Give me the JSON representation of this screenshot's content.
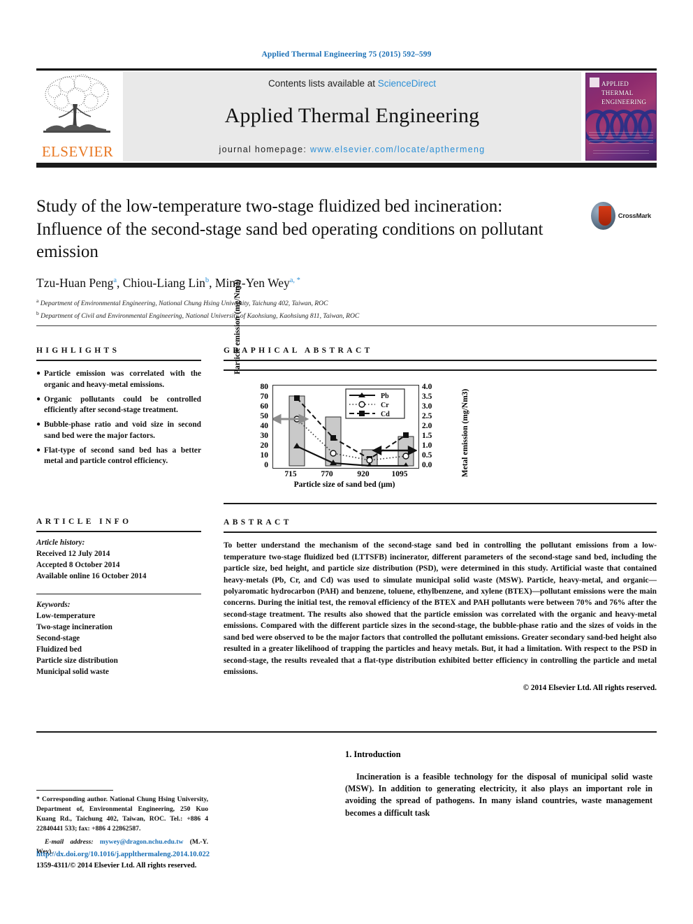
{
  "running_head": "Applied Thermal Engineering 75 (2015) 592–599",
  "masthead": {
    "contents_prefix": "Contents lists available at ",
    "sciencedirect": "ScienceDirect",
    "journal_name": "Applied Thermal Engineering",
    "homepage_label": "journal homepage:",
    "homepage_url": "www.elsevier.com/locate/apthermeng",
    "publisher": "ELSEVIER",
    "cover_title_line1": "APPLIED",
    "cover_title_line2": "THERMAL",
    "cover_title_line3": "ENGINEERING"
  },
  "article": {
    "title": "Study of the low-temperature two-stage fluidized bed incineration: Influence of the second-stage sand bed operating conditions on pollutant emission",
    "crossmark_label": "CrossMark",
    "authors": [
      {
        "name": "Tzu-Huan Peng",
        "marks": "a"
      },
      {
        "name": "Chiou-Liang Lin",
        "marks": "b"
      },
      {
        "name": "Ming-Yen Wey",
        "marks": "a, *"
      }
    ],
    "affiliations": [
      {
        "mark": "a",
        "text": "Department of Environmental Engineering, National Chung Hsing University, Taichung 402, Taiwan, ROC"
      },
      {
        "mark": "b",
        "text": "Department of Civil and Environmental Engineering, National University of Kaohsiung, Kaohsiung 811, Taiwan, ROC"
      }
    ]
  },
  "highlights": {
    "heading": "HIGHLIGHTS",
    "bullet": "●",
    "items": [
      "Particle emission was correlated with the organic and heavy-metal emissions.",
      "Organic pollutants could be controlled efficiently after second-stage treatment.",
      "Bubble-phase ratio and void size in second sand bed were the major factors.",
      "Flat-type of second sand bed has a better metal and particle control efficiency."
    ]
  },
  "article_info": {
    "heading": "ARTICLE INFO",
    "history_label": "Article history:",
    "history": [
      "Received 12 July 2014",
      "Accepted 8 October 2014",
      "Available online 16 October 2014"
    ],
    "keywords_label": "Keywords:",
    "keywords": [
      "Low-temperature",
      "Two-stage incineration",
      "Second-stage",
      "Fluidized bed",
      "Particle size distribution",
      "Municipal solid waste"
    ]
  },
  "graphical_abstract": {
    "heading": "GRAPHICAL ABSTRACT"
  },
  "chart_data": {
    "type": "bar",
    "title": "",
    "xlabel": "Particle size of sand bed (μm)",
    "ylabel": "Particle emission (mg/Nm3)",
    "ylabel_right": "Metal emission (mg/Nm3)",
    "categories": [
      "715",
      "770",
      "920",
      "1095"
    ],
    "ylim": [
      0,
      80
    ],
    "yticks": [
      "80",
      "70",
      "60",
      "50",
      "40",
      "30",
      "20",
      "10",
      "0"
    ],
    "ylim_right": [
      0.0,
      4.0
    ],
    "yticks_right": [
      "4.0",
      "3.5",
      "3.0",
      "2.5",
      "2.0",
      "1.5",
      "1.0",
      "0.5",
      "0.0"
    ],
    "grid": false,
    "legend_position": "top-right",
    "bar_series": {
      "name": "Particle emission",
      "values": [
        72,
        50,
        16,
        30
      ]
    },
    "series": [
      {
        "name": "Pb",
        "marker": "triangle",
        "line": "solid",
        "values": [
          1.0,
          0.15,
          0.0,
          0.0
        ]
      },
      {
        "name": "Cr",
        "marker": "open-circle",
        "line": "dotted",
        "values": [
          1.85,
          0.65,
          0.35,
          0.5
        ]
      },
      {
        "name": "Cd",
        "marker": "filled-square",
        "line": "dashed",
        "values": [
          3.45,
          1.4,
          0.3,
          1.55
        ]
      }
    ],
    "annotations": [
      "left-arrow to particle axis",
      "right-arrow to metal axis"
    ]
  },
  "abstract": {
    "heading": "ABSTRACT",
    "text": "To better understand the mechanism of the second-stage sand bed in controlling the pollutant emissions from a low-temperature two-stage fluidized bed (LTTSFB) incinerator, different parameters of the second-stage sand bed, including the particle size, bed height, and particle size distribution (PSD), were determined in this study. Artificial waste that contained heavy-metals (Pb, Cr, and Cd) was used to simulate municipal solid waste (MSW). Particle, heavy-metal, and organic—polyaromatic hydrocarbon (PAH) and benzene, toluene, ethylbenzene, and xylene (BTEX)—pollutant emissions were the main concerns. During the initial test, the removal efficiency of the BTEX and PAH pollutants were between 70% and 76% after the second-stage treatment. The results also showed that the particle emission was correlated with the organic and heavy-metal emissions. Compared with the different particle sizes in the second-stage, the bubble-phase ratio and the sizes of voids in the sand bed were observed to be the major factors that controlled the pollutant emissions. Greater secondary sand-bed height also resulted in a greater likelihood of trapping the particles and heavy metals. But, it had a limitation. With respect to the PSD in second-stage, the results revealed that a flat-type distribution exhibited better efficiency in controlling the particle and metal emissions.",
    "copyright": "© 2014 Elsevier Ltd. All rights reserved."
  },
  "footnote": {
    "marker": "*",
    "text": "Corresponding author. National Chung Hsing University, Department of, Environmental Engineering, 250 Kuo Kuang Rd., Taichung 402, Taiwan, ROC. Tel.: +886 4 22840441 533; fax: +886 4 22862587.",
    "email_label": "E-mail address:",
    "email": "mywey@dragon.nchu.edu.tw",
    "email_owner": "(M.-Y. Wey)."
  },
  "doi_block": {
    "doi_url": "http://dx.doi.org/10.1016/j.applthermaleng.2014.10.022",
    "issn_line": "1359-4311/© 2014 Elsevier Ltd. All rights reserved."
  },
  "introduction": {
    "number_title": "1. Introduction",
    "paragraph": "Incineration is a feasible technology for the disposal of municipal solid waste (MSW). In addition to generating electricity, it also plays an important role in avoiding the spread of pathogens. In many island countries, waste management becomes a difficult task"
  },
  "colors": {
    "link_blue": "#1a6fb5",
    "sciencedirect_blue": "#2b8fd6",
    "elsevier_orange": "#E87722",
    "bar_gray": "#c9c9c9"
  }
}
